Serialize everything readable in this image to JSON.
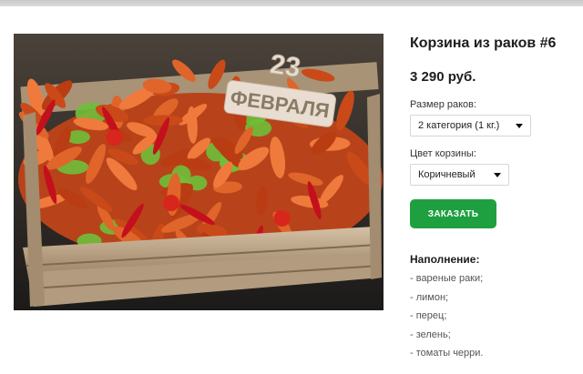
{
  "product": {
    "title": "Корзина из раков #6",
    "price": "3 290 руб.",
    "order_label": "ЗАКАЗАТЬ"
  },
  "options": {
    "size": {
      "label": "Размер раков:",
      "selected": "2 категория (1 кг.)"
    },
    "color": {
      "label": "Цвет корзины:",
      "selected": "Коричневый"
    }
  },
  "filling": {
    "title": "Наполнение:",
    "items": [
      "- вареные раки;",
      "- лимон;",
      "- перец;",
      "- зелень;",
      "- томаты черри."
    ]
  },
  "photo": {
    "sign_line1": "23",
    "sign_line2": "ФЕВРАЛЯ"
  },
  "colors": {
    "accent": "#1fa040",
    "crayfish": "#d9541e",
    "chili": "#c4101c",
    "lettuce": "#6fbf3a",
    "crate": "#b9a184"
  }
}
